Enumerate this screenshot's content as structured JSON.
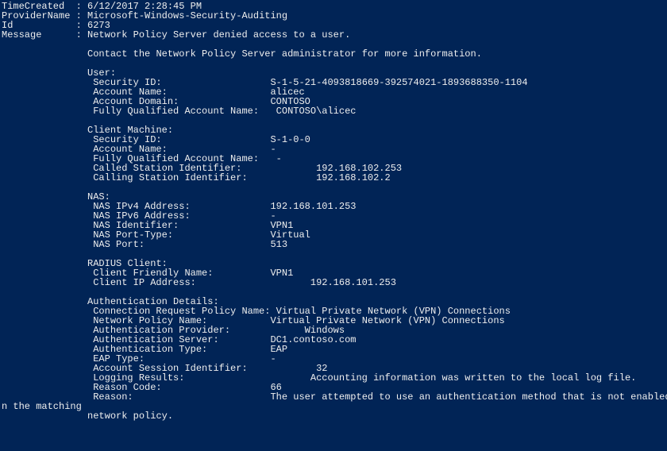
{
  "header": {
    "time_created_label": "TimeCreated",
    "time_created_value": "6/12/2017 2:28:45 PM",
    "provider_name_label": "ProviderName",
    "provider_name_value": "Microsoft-Windows-Security-Auditing",
    "id_label": "Id",
    "id_value": "6273",
    "message_label": "Message",
    "message_value": "Network Policy Server denied access to a user."
  },
  "contact_line": "Contact the Network Policy Server administrator for more information.",
  "user": {
    "header": "User:",
    "security_id_label": "Security ID:",
    "security_id_value": "S-1-5-21-4093818669-392574021-1893688350-1104",
    "account_name_label": "Account Name:",
    "account_name_value": "alicec",
    "account_domain_label": "Account Domain:",
    "account_domain_value": "CONTOSO",
    "fqan_label": "Fully Qualified Account Name:",
    "fqan_value": "CONTOSO\\alicec"
  },
  "client_machine": {
    "header": "Client Machine:",
    "security_id_label": "Security ID:",
    "security_id_value": "S-1-0-0",
    "account_name_label": "Account Name:",
    "account_name_value": "-",
    "fqan_label": "Fully Qualified Account Name:",
    "fqan_value": "-",
    "called_station_label": "Called Station Identifier:",
    "called_station_value": "192.168.102.253",
    "calling_station_label": "Calling Station Identifier:",
    "calling_station_value": "192.168.102.2"
  },
  "nas": {
    "header": "NAS:",
    "ipv4_label": "NAS IPv4 Address:",
    "ipv4_value": "192.168.101.253",
    "ipv6_label": "NAS IPv6 Address:",
    "ipv6_value": "-",
    "identifier_label": "NAS Identifier:",
    "identifier_value": "VPN1",
    "port_type_label": "NAS Port-Type:",
    "port_type_value": "Virtual",
    "port_label": "NAS Port:",
    "port_value": "513"
  },
  "radius": {
    "header": "RADIUS Client:",
    "friendly_name_label": "Client Friendly Name:",
    "friendly_name_value": "VPN1",
    "ip_label": "Client IP Address:",
    "ip_value": "192.168.101.253"
  },
  "auth": {
    "header": "Authentication Details:",
    "conn_policy_label": "Connection Request Policy Name:",
    "conn_policy_value": "Virtual Private Network (VPN) Connections",
    "net_policy_label": "Network Policy Name:",
    "net_policy_value": "Virtual Private Network (VPN) Connections",
    "provider_label": "Authentication Provider:",
    "provider_value": "Windows",
    "server_label": "Authentication Server:",
    "server_value": "DC1.contoso.com",
    "type_label": "Authentication Type:",
    "type_value": "EAP",
    "eap_type_label": "EAP Type:",
    "eap_type_value": "-",
    "session_id_label": "Account Session Identifier:",
    "session_id_value": "32",
    "logging_label": "Logging Results:",
    "logging_value": "Accounting information was written to the local log file.",
    "reason_code_label": "Reason Code:",
    "reason_code_value": "66",
    "reason_label": "Reason:",
    "reason_value": "The user attempted to use an authentication method that is not enabled o",
    "reason_cont1": "n the matching",
    "reason_cont2": "network policy."
  }
}
